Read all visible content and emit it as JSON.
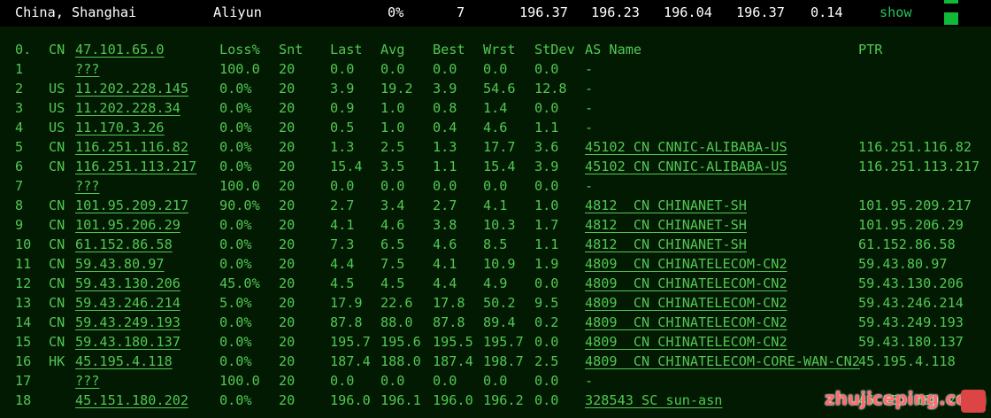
{
  "header": {
    "location": "China, Shanghai",
    "provider": "Aliyun",
    "loss": "0%",
    "count": "7",
    "v1": "196.37",
    "v2": "196.23",
    "v3": "196.04",
    "v4": "196.37",
    "v5": "0.14",
    "show_label": "show"
  },
  "columns": {
    "num": "0.",
    "cc": "CN",
    "host": "47.101.65.0",
    "loss": "Loss%",
    "snt": "Snt",
    "last": "Last",
    "avg": "Avg",
    "best": "Best",
    "wrst": "Wrst",
    "stdev": "StDev",
    "as": "AS Name",
    "ptr": "PTR"
  },
  "rows": [
    {
      "num": "1",
      "cc": "",
      "host": "???",
      "loss": "100.0",
      "snt": "20",
      "last": "0.0",
      "avg": "0.0",
      "best": "0.0",
      "wrst": "0.0",
      "stdev": "0.0",
      "as": "-",
      "ptr": ""
    },
    {
      "num": "2",
      "cc": "US",
      "host": "11.202.228.145",
      "loss": "0.0%",
      "snt": "20",
      "last": "3.9",
      "avg": "19.2",
      "best": "3.9",
      "wrst": "54.6",
      "stdev": "12.8",
      "as": "-",
      "ptr": ""
    },
    {
      "num": "3",
      "cc": "US",
      "host": "11.202.228.34",
      "loss": "0.0%",
      "snt": "20",
      "last": "0.9",
      "avg": "1.0",
      "best": "0.8",
      "wrst": "1.4",
      "stdev": "0.0",
      "as": "-",
      "ptr": ""
    },
    {
      "num": "4",
      "cc": "US",
      "host": "11.170.3.26",
      "loss": "0.0%",
      "snt": "20",
      "last": "0.5",
      "avg": "1.0",
      "best": "0.4",
      "wrst": "4.6",
      "stdev": "1.1",
      "as": "-",
      "ptr": ""
    },
    {
      "num": "5",
      "cc": "CN",
      "host": "116.251.116.82",
      "loss": "0.0%",
      "snt": "20",
      "last": "1.3",
      "avg": "2.5",
      "best": "1.3",
      "wrst": "17.7",
      "stdev": "3.6",
      "as": "45102 CN CNNIC-ALIBABA-US",
      "ptr": "116.251.116.82"
    },
    {
      "num": "6",
      "cc": "CN",
      "host": "116.251.113.217",
      "loss": "0.0%",
      "snt": "20",
      "last": "15.4",
      "avg": "3.5",
      "best": "1.1",
      "wrst": "15.4",
      "stdev": "3.9",
      "as": "45102 CN CNNIC-ALIBABA-US",
      "ptr": "116.251.113.217"
    },
    {
      "num": "7",
      "cc": "",
      "host": "???",
      "loss": "100.0",
      "snt": "20",
      "last": "0.0",
      "avg": "0.0",
      "best": "0.0",
      "wrst": "0.0",
      "stdev": "0.0",
      "as": "-",
      "ptr": ""
    },
    {
      "num": "8",
      "cc": "CN",
      "host": "101.95.209.217",
      "loss": "90.0%",
      "snt": "20",
      "last": "2.7",
      "avg": "3.4",
      "best": "2.7",
      "wrst": "4.1",
      "stdev": "1.0",
      "as": "4812  CN CHINANET-SH",
      "ptr": "101.95.209.217"
    },
    {
      "num": "9",
      "cc": "CN",
      "host": "101.95.206.29",
      "loss": "0.0%",
      "snt": "20",
      "last": "4.1",
      "avg": "4.6",
      "best": "3.8",
      "wrst": "10.3",
      "stdev": "1.7",
      "as": "4812  CN CHINANET-SH",
      "ptr": "101.95.206.29"
    },
    {
      "num": "10",
      "cc": "CN",
      "host": "61.152.86.58",
      "loss": "0.0%",
      "snt": "20",
      "last": "7.3",
      "avg": "6.5",
      "best": "4.6",
      "wrst": "8.5",
      "stdev": "1.1",
      "as": "4812  CN CHINANET-SH",
      "ptr": "61.152.86.58"
    },
    {
      "num": "11",
      "cc": "CN",
      "host": "59.43.80.97",
      "loss": "0.0%",
      "snt": "20",
      "last": "4.4",
      "avg": "7.5",
      "best": "4.1",
      "wrst": "10.9",
      "stdev": "1.9",
      "as": "4809  CN CHINATELECOM-CN2",
      "ptr": "59.43.80.97"
    },
    {
      "num": "12",
      "cc": "CN",
      "host": "59.43.130.206",
      "loss": "45.0%",
      "snt": "20",
      "last": "4.5",
      "avg": "4.5",
      "best": "4.4",
      "wrst": "4.9",
      "stdev": "0.0",
      "as": "4809  CN CHINATELECOM-CN2",
      "ptr": "59.43.130.206"
    },
    {
      "num": "13",
      "cc": "CN",
      "host": "59.43.246.214",
      "loss": "5.0%",
      "snt": "20",
      "last": "17.9",
      "avg": "22.6",
      "best": "17.8",
      "wrst": "50.2",
      "stdev": "9.5",
      "as": "4809  CN CHINATELECOM-CN2",
      "ptr": "59.43.246.214"
    },
    {
      "num": "14",
      "cc": "CN",
      "host": "59.43.249.193",
      "loss": "0.0%",
      "snt": "20",
      "last": "87.8",
      "avg": "88.0",
      "best": "87.8",
      "wrst": "89.4",
      "stdev": "0.2",
      "as": "4809  CN CHINATELECOM-CN2",
      "ptr": "59.43.249.193"
    },
    {
      "num": "15",
      "cc": "CN",
      "host": "59.43.180.137",
      "loss": "0.0%",
      "snt": "20",
      "last": "195.7",
      "avg": "195.6",
      "best": "195.5",
      "wrst": "195.7",
      "stdev": "0.0",
      "as": "4809  CN CHINATELECOM-CN2",
      "ptr": "59.43.180.137"
    },
    {
      "num": "16",
      "cc": "HK",
      "host": "45.195.4.118",
      "loss": "0.0%",
      "snt": "20",
      "last": "187.4",
      "avg": "188.0",
      "best": "187.4",
      "wrst": "198.7",
      "stdev": "2.5",
      "as": "4809  CN CHINATELECOM-CORE-WAN-CN2",
      "ptr": "45.195.4.118"
    },
    {
      "num": "17",
      "cc": "",
      "host": "???",
      "loss": "100.0",
      "snt": "20",
      "last": "0.0",
      "avg": "0.0",
      "best": "0.0",
      "wrst": "0.0",
      "stdev": "0.0",
      "as": "-",
      "ptr": ""
    },
    {
      "num": "18",
      "cc": "",
      "host": "45.151.180.202",
      "loss": "0.0%",
      "snt": "20",
      "last": "196.0",
      "avg": "196.1",
      "best": "196.0",
      "wrst": "196.2",
      "stdev": "0.0",
      "as": "328543 SC sun-asn",
      "ptr": "45.151.180.202"
    }
  ],
  "watermark": "zhujiceping.com",
  "colors": {
    "terminal_bg": "#021a02",
    "terminal_text": "#53c653",
    "show_link": "#22c55e",
    "status_square": "#10b937",
    "watermark": "#ff6b6b"
  }
}
